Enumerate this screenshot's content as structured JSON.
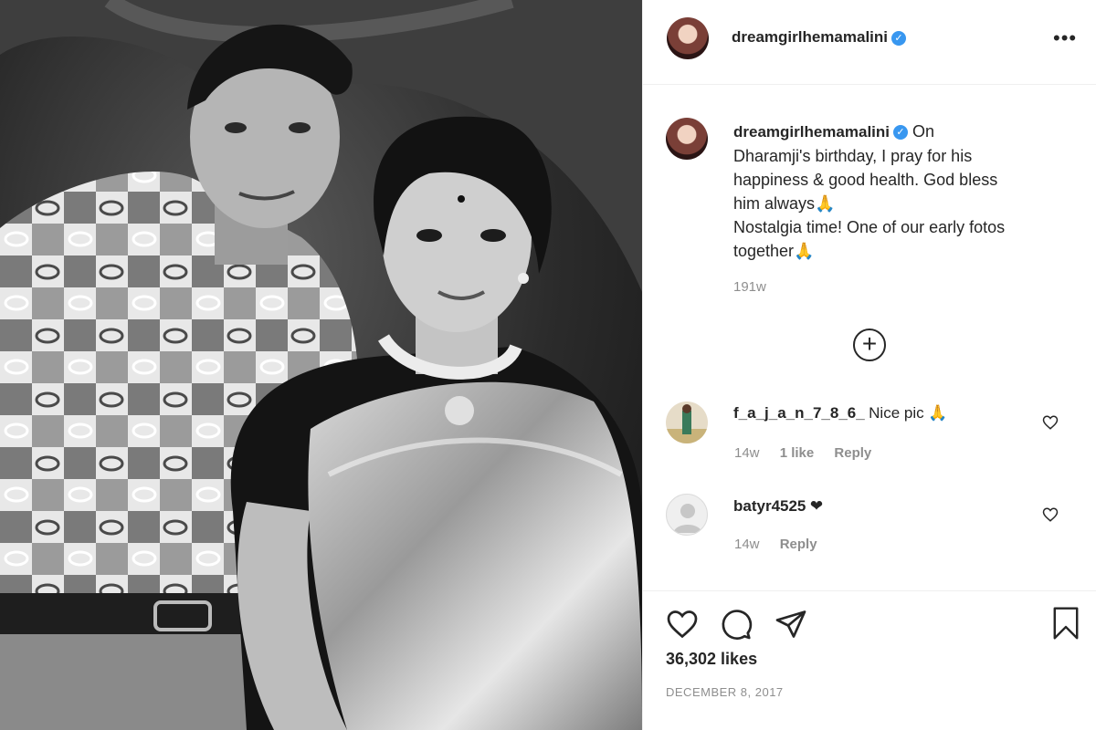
{
  "post": {
    "username": "dreamgirlhemamalini",
    "verified_icon": "verified-check-icon",
    "caption": "On\nDharamji's birthday, I pray for his\nhappiness & good health. God bless\nhim always🙏\nNostalgia time! One of our early fotos\ntogether🙏",
    "caption_age": "191w",
    "likes": "36,302 likes",
    "date": "DECEMBER 8, 2017"
  },
  "comments": [
    {
      "username": "f_a_j_a_n_7_8_6_",
      "text": "Nice pic 🙏",
      "age": "14w",
      "likes": "1 like",
      "reply": "Reply"
    },
    {
      "username": "batyr4525",
      "text": "❤",
      "age": "14w",
      "reply": "Reply"
    }
  ],
  "icons": {
    "more": "more-options-icon",
    "load_more": "plus-circle-icon",
    "like": "heart-icon",
    "comment": "comment-icon",
    "share": "share-icon",
    "save": "bookmark-icon"
  },
  "colors": {
    "verified": "#3897f0",
    "text": "#262626",
    "muted": "#8e8e8e",
    "border": "#efefef"
  }
}
